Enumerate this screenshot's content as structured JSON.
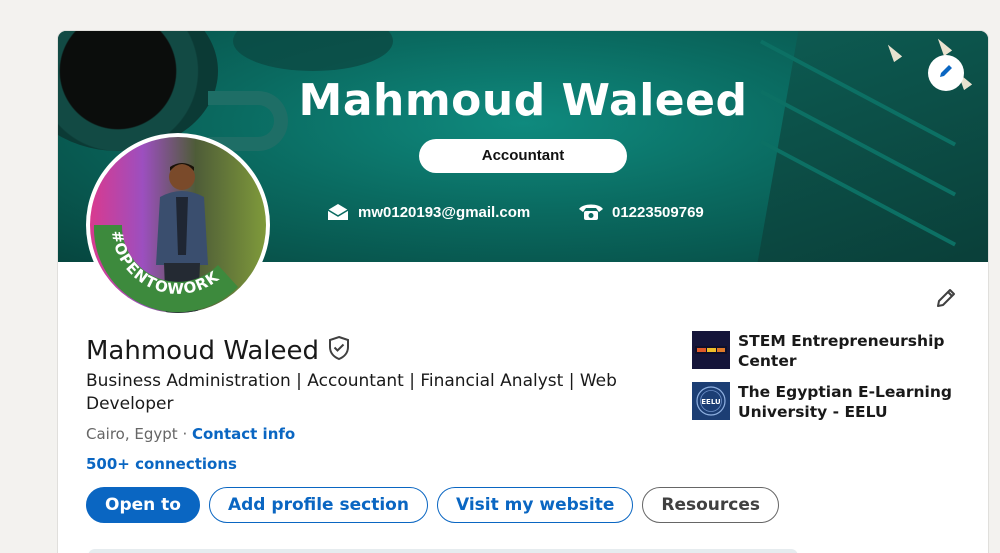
{
  "banner": {
    "title": "Mahmoud Waleed",
    "role": "Accountant",
    "email": "mw0120193@gmail.com",
    "phone": "01223509769",
    "colors": {
      "teal_dark": "#06463f",
      "teal": "#0f8a7e"
    }
  },
  "avatar": {
    "badge_text": "#OPENTOWORK",
    "ring_color": "#3d8a3d"
  },
  "profile": {
    "name": "Mahmoud Waleed",
    "headline": "Business Administration | Accountant | Financial Analyst | Web Developer",
    "location": "Cairo, Egypt",
    "separator": " · ",
    "contact_link": "Contact info",
    "connections": "500+ connections"
  },
  "buttons": {
    "open_to": "Open to",
    "add_section": "Add profile section",
    "visit_website": "Visit my website",
    "resources": "Resources"
  },
  "organizations": [
    {
      "name": "STEM Entrepreneurship Center",
      "logo_text": ""
    },
    {
      "name": "The Egyptian E-Learning University - EELU",
      "logo_text": "EELU"
    }
  ],
  "icons": {
    "banner_edit": "pencil-icon",
    "intro_edit": "pencil-icon",
    "verified": "shield-check-icon",
    "email": "mail-icon",
    "phone": "phone-icon"
  },
  "theme": {
    "linkedin_blue": "#0a66c2",
    "page_bg": "#f3f2ef"
  }
}
